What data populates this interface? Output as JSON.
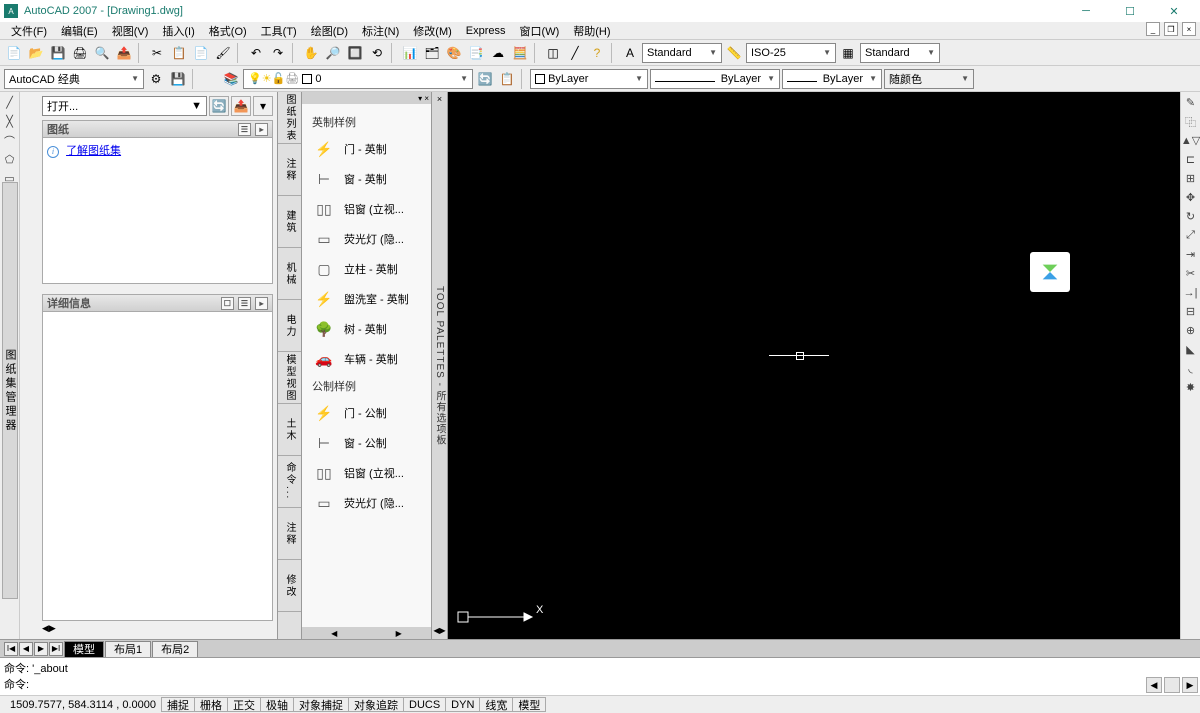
{
  "title": "AutoCAD 2007 - [Drawing1.dwg]",
  "menu": [
    "文件(F)",
    "编辑(E)",
    "视图(V)",
    "插入(I)",
    "格式(O)",
    "工具(T)",
    "绘图(D)",
    "标注(N)",
    "修改(M)",
    "Express",
    "窗口(W)",
    "帮助(H)"
  ],
  "toolbar1": {
    "combo_style1": "Standard",
    "combo_style2": "ISO-25",
    "combo_style3": "Standard"
  },
  "toolbar2": {
    "workspace": "AutoCAD 经典",
    "layer": "0",
    "color": "ByLayer",
    "linetype": "ByLayer",
    "lineweight": "ByLayer",
    "plotcolor": "随颜色"
  },
  "sheet_panel": {
    "open_combo": "打开...",
    "section1": "图纸",
    "section2": "详细信息",
    "link": "了解图纸集",
    "side_label": "图纸集管理器"
  },
  "mid_tabs": [
    "图纸列表",
    "注释",
    "建筑",
    "机械",
    "电力",
    "模型视图",
    "土木",
    "命令...",
    "注释",
    "修改"
  ],
  "palette": {
    "section1": "英制样例",
    "items1": [
      "门 - 英制",
      "窗 - 英制",
      "铝窗 (立视...",
      "荧光灯 (隐...",
      "立柱 - 英制",
      "盥洗室 - 英制",
      "树 - 英制",
      "车辆 - 英制"
    ],
    "section2": "公制样例",
    "items2": [
      "门 - 公制",
      "窗 - 公制",
      "铝窗 (立视...",
      "荧光灯 (隐..."
    ],
    "side_label": "TOOL PALETTES - 所有选项板"
  },
  "bottom_tabs": [
    "模型",
    "布局1",
    "布局2"
  ],
  "command": {
    "line1": "命令: '_about",
    "line2": "命令:"
  },
  "status": {
    "coord": "1509.7577, 584.3114 , 0.0000",
    "buttons": [
      "捕捉",
      "栅格",
      "正交",
      "极轴",
      "对象捕捉",
      "对象追踪",
      "DUCS",
      "DYN",
      "线宽",
      "模型"
    ]
  }
}
